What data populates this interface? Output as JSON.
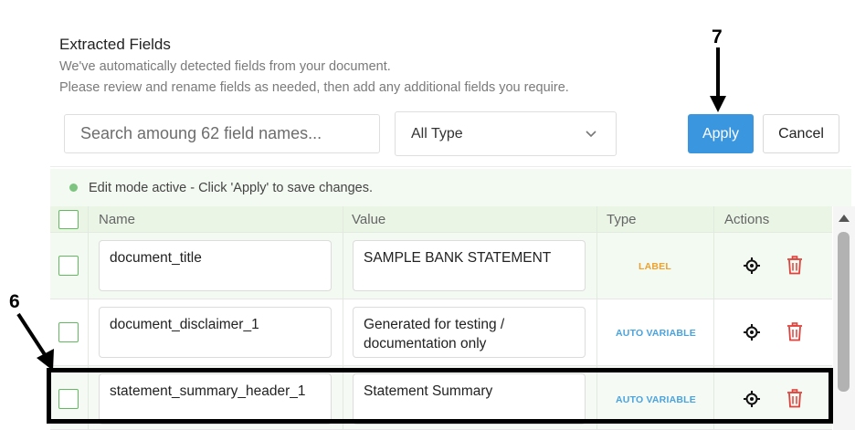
{
  "header": {
    "title": "Extracted Fields",
    "desc_line1": "We've automatically detected fields from your document.",
    "desc_line2": "Please review and rename fields as needed, then add any additional fields you require."
  },
  "search": {
    "placeholder": "Search amoung 62 field names...",
    "value": ""
  },
  "type_filter": {
    "selected": "All Type"
  },
  "toolbar": {
    "apply_label": "Apply",
    "cancel_label": "Cancel"
  },
  "status": {
    "text": "Edit mode active - Click 'Apply' to save changes."
  },
  "table": {
    "headers": {
      "name": "Name",
      "value": "Value",
      "type": "Type",
      "actions": "Actions"
    },
    "rows": [
      {
        "name": "document_title",
        "value_line1": "SAMPLE BANK STATEMENT",
        "value_line2": "",
        "type": "LABEL"
      },
      {
        "name": "document_disclaimer_1",
        "value_line1": "Generated for testing /",
        "value_line2": "documentation only",
        "type": "AUTO VARIABLE"
      },
      {
        "name": "statement_summary_header_1",
        "value_line1": "Statement Summary",
        "value_line2": "",
        "type": "AUTO VARIABLE"
      }
    ]
  },
  "annotations": {
    "step_apply": "7",
    "step_row": "6"
  },
  "colors": {
    "accent": "#3a97df",
    "check_border": "#63b95f",
    "label_badge": "#f0a02c",
    "auto_badge": "#4aa3df",
    "delete": "#e0413b",
    "status_dot": "#7cc47f"
  },
  "icons": {
    "filter_dropdown": "chevron-down-icon",
    "locate": "crosshair-icon",
    "delete": "trash-icon",
    "scroll": "scroll-up-arrow-icon"
  }
}
